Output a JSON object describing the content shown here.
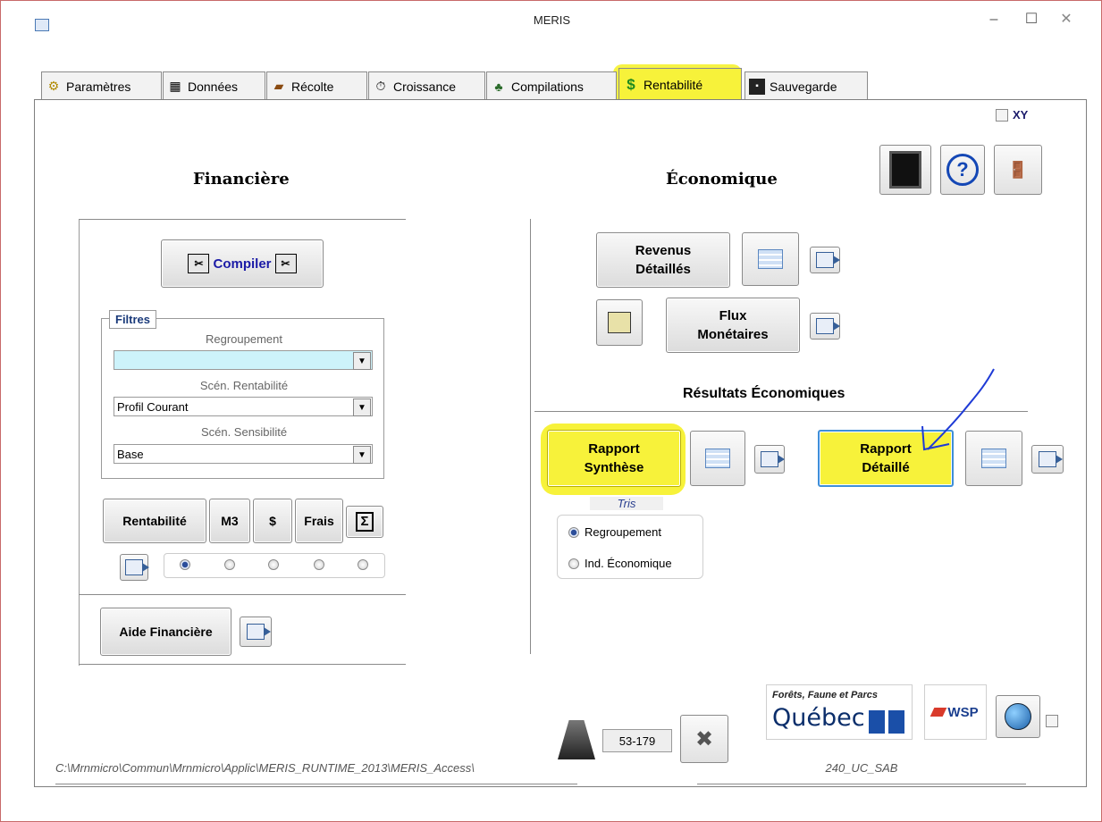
{
  "window": {
    "title": "MERIS",
    "minimize": "–",
    "maximize": "☐",
    "close": "✕"
  },
  "tabs": [
    {
      "label": "Paramètres"
    },
    {
      "label": "Données"
    },
    {
      "label": "Récolte"
    },
    {
      "label": "Croissance"
    },
    {
      "label": "Compilations"
    },
    {
      "label": "Rentabilité",
      "active": true
    },
    {
      "label": "Sauvegarde"
    }
  ],
  "xy": {
    "label": "XY",
    "checked": false
  },
  "financiere": {
    "heading": "Financière",
    "compile_label": "Compiler",
    "filters": {
      "legend": "Filtres",
      "regroupement_label": "Regroupement",
      "regroupement_value": "",
      "scen_rentabilite_label": "Scén. Rentabilité",
      "scen_rentabilite_value": "Profil Courant",
      "scen_sensibilite_label": "Scén. Sensibilité",
      "scen_sensibilite_value": "Base"
    },
    "buttons": {
      "rentabilite": "Rentabilité",
      "m3": "M3",
      "dollar": "$",
      "frais": "Frais",
      "sigma": "Σ"
    },
    "aide_label": "Aide Financière"
  },
  "economique": {
    "heading": "Économique",
    "revenus_line1": "Revenus",
    "revenus_line2": "Détaillés",
    "flux_line1": "Flux",
    "flux_line2": "Monétaires",
    "resultats_heading": "Résultats Économiques",
    "synthese_line1": "Rapport",
    "synthese_line2": "Synthèse",
    "detaille_line1": "Rapport",
    "detaille_line2": "Détaillé",
    "tris_label": "Tris",
    "tris_options": [
      "Regroupement",
      "Ind. Économique"
    ],
    "tris_selected": 0
  },
  "footer": {
    "path": "C:\\Mrnmicro\\Commun\\Mrnmicro\\Applic\\MERIS_RUNTIME_2013\\MERIS_Access\\",
    "code": "53-179",
    "station": "240_UC_SAB",
    "quebec_line1": "Forêts, Faune et Parcs",
    "quebec_line2": "Québec",
    "wsp": "WSP"
  },
  "colors": {
    "highlight": "#f7f23a",
    "annotation": "#1f3bd6",
    "regroupement_fill": "#cdf3fb",
    "link_blue": "#1a1aa6"
  }
}
